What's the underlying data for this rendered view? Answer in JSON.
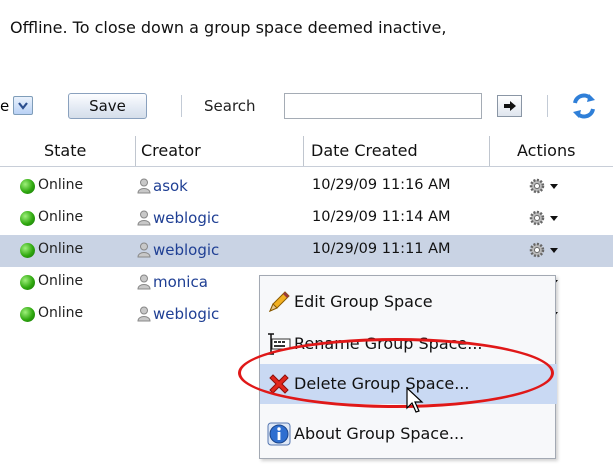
{
  "intro_text": "Offline. To close down a group space deemed inactive,",
  "toolbar": {
    "view_text": "e",
    "save_label": "Save",
    "search_label": "Search",
    "search_value": ""
  },
  "table": {
    "columns": [
      "State",
      "Creator",
      "Date Created",
      "Actions"
    ],
    "rows": [
      {
        "state": "Online",
        "creator": "asok",
        "date": "10/29/09 11:16 AM"
      },
      {
        "state": "Online",
        "creator": "weblogic",
        "date": "10/29/09 11:14 AM"
      },
      {
        "state": "Online",
        "creator": "weblogic",
        "date": "10/29/09 11:11 AM",
        "selected": true
      },
      {
        "state": "Online",
        "creator": "monica",
        "date": ""
      },
      {
        "state": "Online",
        "creator": "weblogic",
        "date": ""
      }
    ]
  },
  "context_menu": {
    "items": [
      {
        "label": "Edit Group Space",
        "icon": "pencil-icon"
      },
      {
        "label": "Rename Group Space...",
        "icon": "rename-icon"
      },
      {
        "label": "Delete Group Space...",
        "icon": "red-x-icon",
        "highlighted": true
      },
      {
        "label": "About Group Space...",
        "icon": "info-icon"
      }
    ]
  },
  "colors": {
    "link": "#1f3f94",
    "selected_row": "#c9d3e4",
    "menu_hover": "#c9d9f3",
    "annotation_ellipse": "#e01818",
    "online_dot": "#2fa80f"
  }
}
